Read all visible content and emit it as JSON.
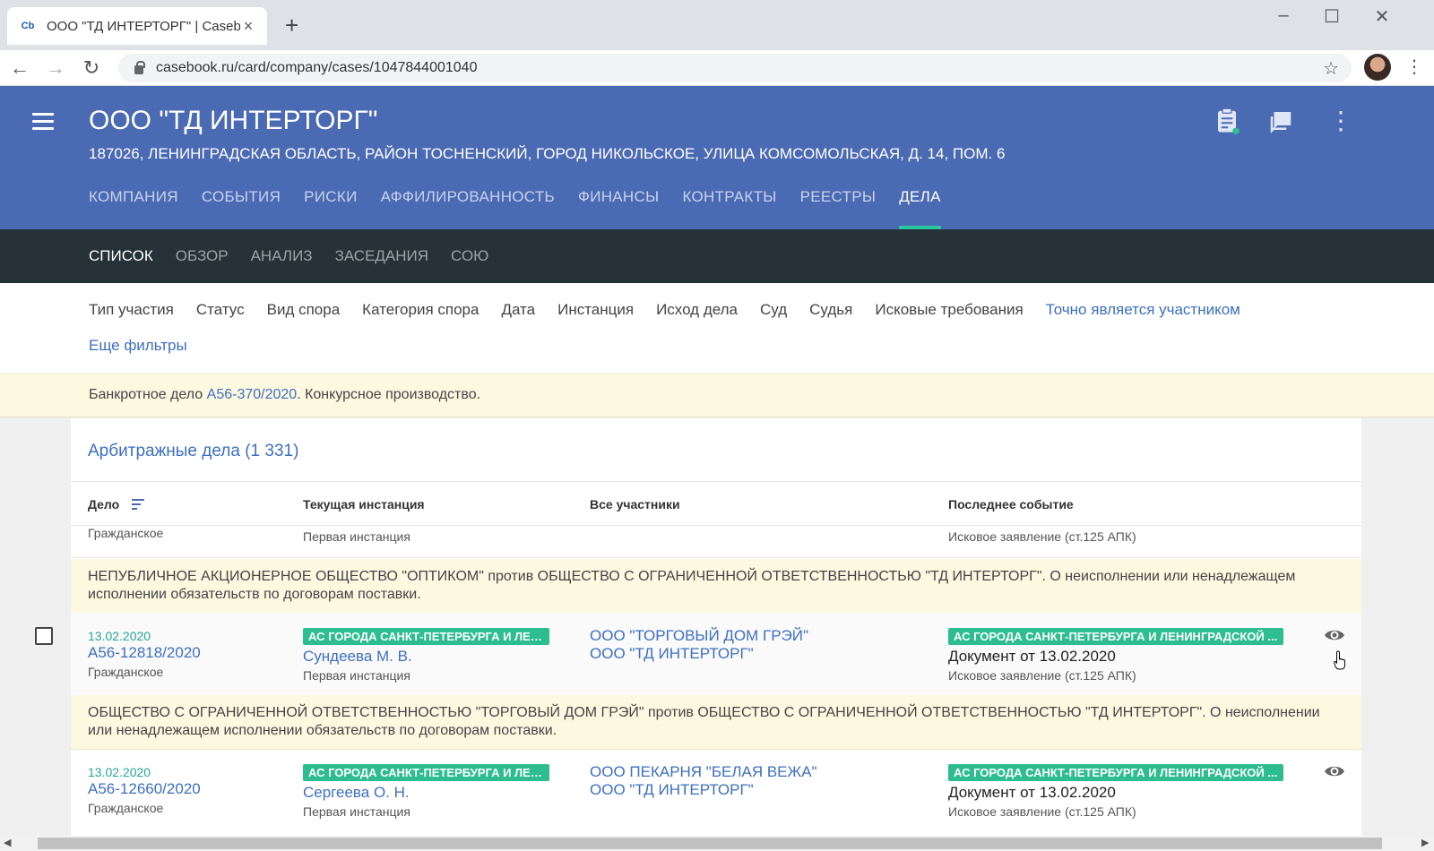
{
  "browser": {
    "tab_favicon": "Cb",
    "tab_title": "ООО \"ТД ИНТЕРТОРГ\" | Casebook",
    "new_tab": "+",
    "url": "casebook.ru/card/company/cases/1047844001040"
  },
  "header": {
    "company_title": "ООО \"ТД ИНТЕРТОРГ\"",
    "address": "187026, ЛЕНИНГРАДСКАЯ ОБЛАСТЬ, РАЙОН ТОСНЕНСКИЙ, ГОРОД НИКОЛЬСКОЕ, УЛИЦА КОМСОМОЛЬСКАЯ, Д. 14, ПОМ. 6",
    "tabs": [
      "КОМПАНИЯ",
      "СОБЫТИЯ",
      "РИСКИ",
      "АФФИЛИРОВАННОСТЬ",
      "ФИНАНСЫ",
      "КОНТРАКТЫ",
      "РЕЕСТРЫ",
      "ДЕЛА"
    ],
    "active_tab": "ДЕЛА"
  },
  "subnav": {
    "tabs": [
      "СПИСОК",
      "ОБЗОР",
      "АНАЛИЗ",
      "ЗАСЕДАНИЯ",
      "СОЮ"
    ],
    "active_tab": "СПИСОК"
  },
  "filters": {
    "items": [
      "Тип участия",
      "Статус",
      "Вид спора",
      "Категория спора",
      "Дата",
      "Инстанция",
      "Исход дела",
      "Суд",
      "Судья",
      "Исковые требования"
    ],
    "link": "Точно является участником",
    "more": "Еще фильтры"
  },
  "banner": {
    "prefix": "Банкротное дело ",
    "case_link": "А56-370/2020",
    "suffix": ". Конкурсное производство."
  },
  "cases": {
    "title": "Арбитражные дела (1 331)",
    "columns": [
      "Дело",
      "Текущая инстанция",
      "Все участники",
      "Последнее событие"
    ],
    "partial": {
      "type": "Гражданское",
      "instance": "Первая инстанция",
      "event": "Исковое заявление (ст.125 АПК)"
    },
    "rows": [
      {
        "description": "НЕПУБЛИЧНОЕ АКЦИОНЕРНОЕ ОБЩЕСТВО \"ОПТИКОМ\" против ОБЩЕСТВО С ОГРАНИЧЕННОЙ ОТВЕТСТВЕННОСТЬЮ \"ТД ИНТЕРТОРГ\". О неисполнении или ненадлежащем исполнении обязательств по договорам поставки.",
        "date": "13.02.2020",
        "number": "А56-12818/2020",
        "type": "Гражданское",
        "court_badge": "АС ГОРОДА САНКТ-ПЕТЕРБУРГА И ЛЕН...",
        "judge": "Сундеева М. В.",
        "instance": "Первая инстанция",
        "party1": "ООО \"ТОРГОВЫЙ ДОМ ГРЭЙ\"",
        "party2": "ООО \"ТД ИНТЕРТОРГ\"",
        "event_badge": "АС ГОРОДА САНКТ-ПЕТЕРБУРГА И ЛЕНИНГРАДСКОЙ ...",
        "document": "Документ от 13.02.2020",
        "event": "Исковое заявление (ст.125 АПК)"
      },
      {
        "description": "ОБЩЕСТВО С ОГРАНИЧЕННОЙ ОТВЕТСТВЕННОСТЬЮ \"ТОРГОВЫЙ ДОМ ГРЭЙ\" против ОБЩЕСТВО С ОГРАНИЧЕННОЙ ОТВЕТСТВЕННОСТЬЮ \"ТД ИНТЕРТОРГ\". О неисполнении или ненадлежащем исполнении обязательств по договорам поставки.",
        "date": "13.02.2020",
        "number": "А56-12660/2020",
        "type": "Гражданское",
        "court_badge": "АС ГОРОДА САНКТ-ПЕТЕРБУРГА И ЛЕН...",
        "judge": "Сергеева О. Н.",
        "instance": "Первая инстанция",
        "party1": "ООО ПЕКАРНЯ \"БЕЛАЯ ВЕЖА\"",
        "party2": "ООО \"ТД ИНТЕРТОРГ\"",
        "event_badge": "АС ГОРОДА САНКТ-ПЕТЕРБУРГА И ЛЕНИНГРАДСКОЙ ...",
        "document": "Документ от 13.02.2020",
        "event": "Исковое заявление (ст.125 АПК)"
      }
    ]
  },
  "colors": {
    "header_bg": "#4a6ab3",
    "subnav_bg": "#263238",
    "accent_green": "#2dbd8f",
    "link_blue": "#3d6fc1",
    "highlight_bg": "#fdf8e0"
  },
  "icons": [
    "menu-icon",
    "clipboard-icon",
    "chat-icon",
    "more-vert-icon",
    "sort-icon",
    "eye-icon",
    "star-icon",
    "lock-icon"
  ]
}
